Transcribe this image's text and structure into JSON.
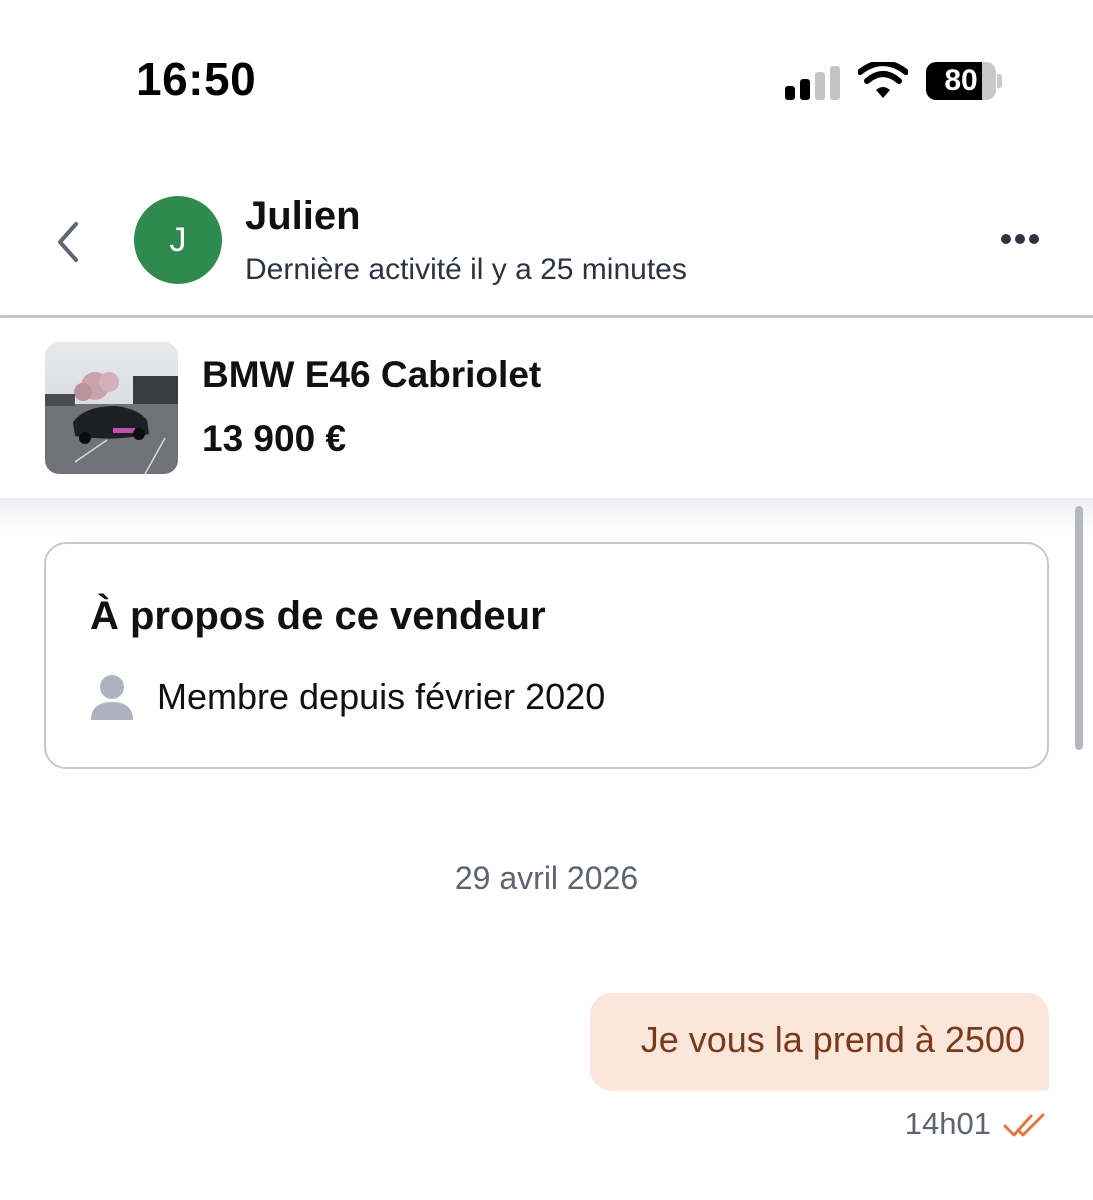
{
  "status_bar": {
    "time": "16:50",
    "battery_level": "80",
    "icons": [
      "signal-icon",
      "wifi-icon",
      "battery-icon"
    ]
  },
  "header": {
    "avatar_initial": "J",
    "avatar_color": "#2f8a4f",
    "name": "Julien",
    "last_activity": "Dernière activité il y a 25 minutes",
    "icons": [
      "back-chevron-icon",
      "more-options-icon"
    ]
  },
  "listing": {
    "title": "BMW E46 Cabriolet",
    "price": "13 900 €"
  },
  "seller_card": {
    "title": "À propos de ce vendeur",
    "member_since": "Membre depuis février 2020"
  },
  "conversation": {
    "date_separator": "29 avril 2026",
    "messages": [
      {
        "text": "Je vous la prend à 2500",
        "time": "14h01",
        "status": "read",
        "bubble_color": "#fbe6db",
        "text_color": "#7a3a17",
        "read_icon_color": "#e8743b"
      }
    ]
  }
}
